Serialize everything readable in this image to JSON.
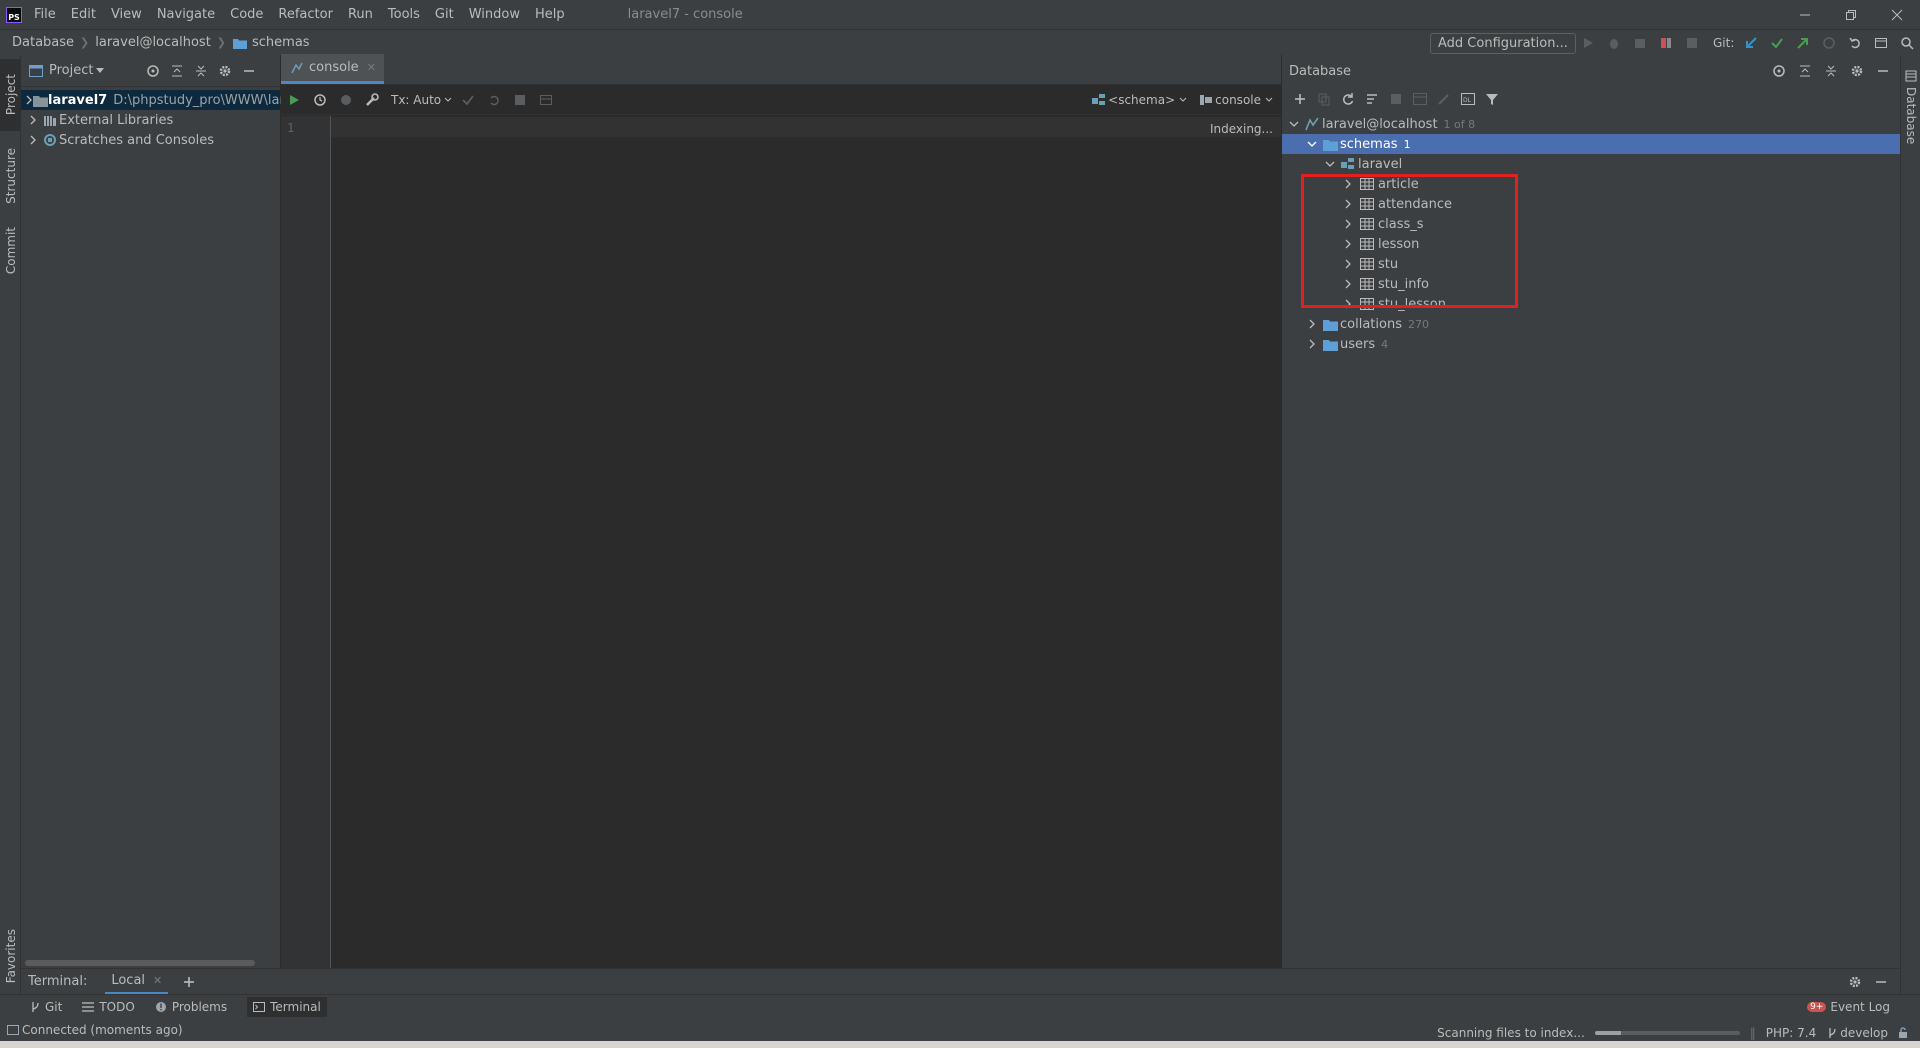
{
  "window": {
    "title": "laravel7 - console",
    "logo_text": "PS",
    "menu": [
      "File",
      "Edit",
      "View",
      "Navigate",
      "Code",
      "Refactor",
      "Run",
      "Tools",
      "Git",
      "Window",
      "Help"
    ]
  },
  "navbar": {
    "breadcrumb": [
      "Database",
      "laravel@localhost",
      "schemas"
    ],
    "add_configuration": "Add Configuration...",
    "git_label": "Git:"
  },
  "left_strip": {
    "project": "Project",
    "structure": "Structure",
    "commit": "Commit",
    "favorites": "Favorites"
  },
  "project_panel": {
    "title": "Project",
    "items": [
      {
        "name": "laravel7",
        "path": "D:\\phpstudy_pro\\WWW\\lara"
      },
      {
        "name": "External Libraries"
      },
      {
        "name": "Scratches and Consoles"
      }
    ]
  },
  "editor": {
    "tab": "console",
    "tx_mode": "Tx: Auto",
    "schema_selector": "<schema>",
    "console_selector": "console",
    "line_number": "1",
    "status": "Indexing..."
  },
  "database": {
    "title": "Database",
    "root": {
      "name": "laravel@localhost",
      "badge": "1 of 8"
    },
    "schemas": {
      "name": "schemas",
      "count": "1"
    },
    "schema": "laravel",
    "tables": [
      "article",
      "attendance",
      "class_s",
      "lesson",
      "stu",
      "stu_info",
      "stu_lesson"
    ],
    "collations": {
      "name": "collations",
      "count": "270"
    },
    "users": {
      "name": "users",
      "count": "4"
    },
    "highlight_color": "#e32020",
    "selection_color": "#4b6eaf"
  },
  "right_strip": {
    "database": "Database"
  },
  "terminal": {
    "label": "Terminal:",
    "tab": "Local"
  },
  "bottom_tabs": {
    "git": "Git",
    "todo": "TODO",
    "problems": "Problems",
    "terminal": "Terminal",
    "event_log": "Event Log",
    "event_count": "9+"
  },
  "status": {
    "left": "Connected (moments ago)",
    "scanning": "Scanning files to index...",
    "scan_progress": 0.18,
    "php": "PHP: 7.4",
    "branch": "develop"
  }
}
